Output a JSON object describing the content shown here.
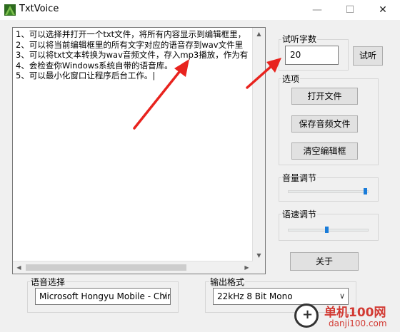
{
  "window": {
    "title": "TxtVoice",
    "minimize_glyph": "—",
    "maximize_glyph": "☐",
    "close_glyph": "✕"
  },
  "editor": {
    "lines": [
      "1、可以选择并打开一个txt文件，将所有内容显示到编辑框里，",
      "2、可以将当前编辑框里的所有文字对应的语音存到wav文件里",
      "3、可以将txt文本转换为wav音频文件，存入mp3播放，作为有",
      "4、会检查你Windows系统自带的语音库。",
      "5、可以最小化窗口让程序后台工作。|"
    ]
  },
  "preview": {
    "label": "试听字数",
    "value": "20",
    "button": "试听"
  },
  "options": {
    "label": "选项",
    "open_file": "打开文件",
    "save_audio": "保存音频文件",
    "clear_editor": "清空编辑框"
  },
  "volume": {
    "label": "音量调节",
    "level": 0.98
  },
  "speed": {
    "label": "语速调节",
    "level": 0.48
  },
  "about_button": "关于",
  "voice": {
    "label": "语音选择",
    "selected": "Microsoft Hongyu Mobile - Chir"
  },
  "format": {
    "label": "输出格式",
    "selected": "22kHz 8 Bit Mono"
  },
  "watermark": {
    "name": "单机100网",
    "url": "danji100.com"
  },
  "colors": {
    "accent": "#1a7cd9",
    "annotation_arrow": "#e8231e",
    "window_bg": "#f0f0f0"
  },
  "icons": {
    "app": "txtvoice-app-icon",
    "dropdown": "chevron-down-icon",
    "annotation": "red-arrow-icon"
  }
}
